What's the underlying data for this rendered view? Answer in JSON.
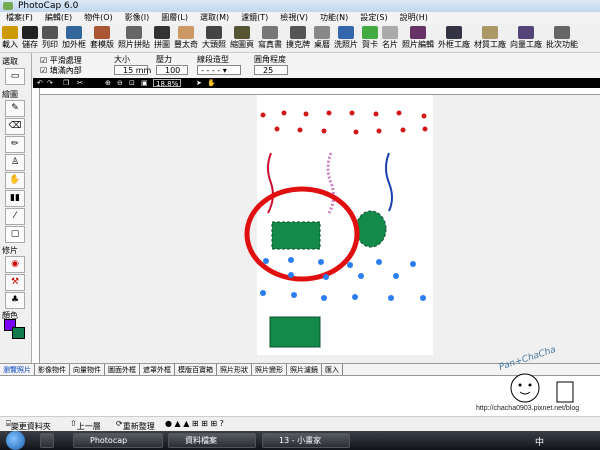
{
  "window": {
    "title": "PhotoCap 6.0"
  },
  "menu": [
    "檔案(F)",
    "編輯(E)",
    "物件(O)",
    "影像(I)",
    "圖層(L)",
    "選取(M)",
    "濾鏡(T)",
    "檢視(V)",
    "功能(N)",
    "設定(S)",
    "說明(H)"
  ],
  "toolbar": [
    "載入",
    "儲存",
    "列印",
    "加外框",
    "套模版",
    "照片拼貼",
    "拼圖",
    "豐太奇",
    "大頭照",
    "縮圖頁",
    "寫真書",
    "撲克牌",
    "桌曆",
    "洗照片",
    "賀卡",
    "名片",
    "照片編輯",
    "外框工廠",
    "材質工廠",
    "向量工廠",
    "批次功能"
  ],
  "options": {
    "smooth": "平滑處理",
    "fill": "填滿內部",
    "size_label": "大小",
    "size_value": "15 mm",
    "pressure_label": "壓力",
    "pressure_value": "100",
    "line_style_label": "線段造型",
    "corner_label": "圓角程度",
    "corner_value": "25"
  },
  "side": {
    "select": "選取",
    "draw": "繪圖",
    "retouch": "修片",
    "color": "顏色"
  },
  "colors": {
    "foreground": "#7a00ff",
    "background": "#117a4a",
    "shape_green": "#138a4a",
    "dot_red": "#d01818",
    "dot_blue": "#2a7ef0",
    "ellipse_red": "#e01010"
  },
  "zoom": "18.8%",
  "tabs": [
    "瀏覽照片",
    "影像物件",
    "向量物件",
    "圖面外框",
    "遮罩外框",
    "模版百寶箱",
    "照片形狀",
    "照片變形",
    "照片濾鏡",
    "匯入"
  ],
  "bottom": {
    "change_folder": "變更資料夾",
    "up": "上一層",
    "refresh": "重新整理"
  },
  "taskbar": [
    "Photocap",
    "資料檔案",
    "13 - 小畫家"
  ],
  "watermark": {
    "text": "Pan+ChaCha",
    "url": "http://chacha0903.pixnet.net/blog"
  },
  "tray": {
    "ime": "中"
  }
}
